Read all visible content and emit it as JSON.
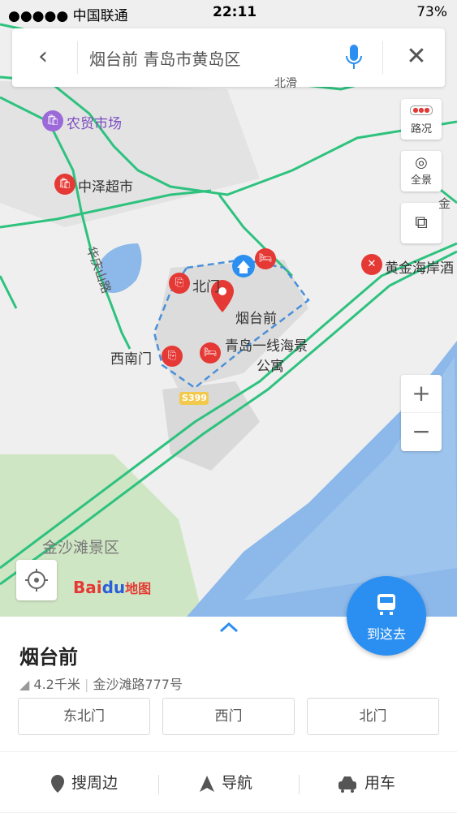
{
  "status": {
    "carrier": "●●●●● 中国联通",
    "time": "22:11",
    "battery": "73%"
  },
  "search": {
    "query": "烟台前 青岛市黄岛区"
  },
  "side": {
    "traffic": "路况",
    "panorama": "全景"
  },
  "map_labels": {
    "market": "农贸市场",
    "supermarket": "中泽超市",
    "road": "华庆山路",
    "north_gate": "北门",
    "place": "烟台前",
    "southwest_gate": "西南门",
    "apartment_line1": "青岛一线海景",
    "apartment_line2": "公寓",
    "highway": "S399",
    "beach_area": "金沙滩景区",
    "restaurant": "黄金海岸酒",
    "road_top": "北滑",
    "road_right": "金"
  },
  "logo": {
    "bai": "Bai",
    "du": "du",
    "ditu": "地图"
  },
  "goto_label": "到这去",
  "panel": {
    "title": "烟台前",
    "distance": "4.2千米",
    "address": "金沙滩路777号",
    "gates": [
      "东北门",
      "西门",
      "北门"
    ],
    "actions": {
      "nearby": "搜周边",
      "navigate": "导航",
      "car": "用车"
    }
  },
  "colors": {
    "accent": "#2b8ff2",
    "road": "#2ec27e",
    "water": "#8cb8ea",
    "poi": "#e53935"
  }
}
